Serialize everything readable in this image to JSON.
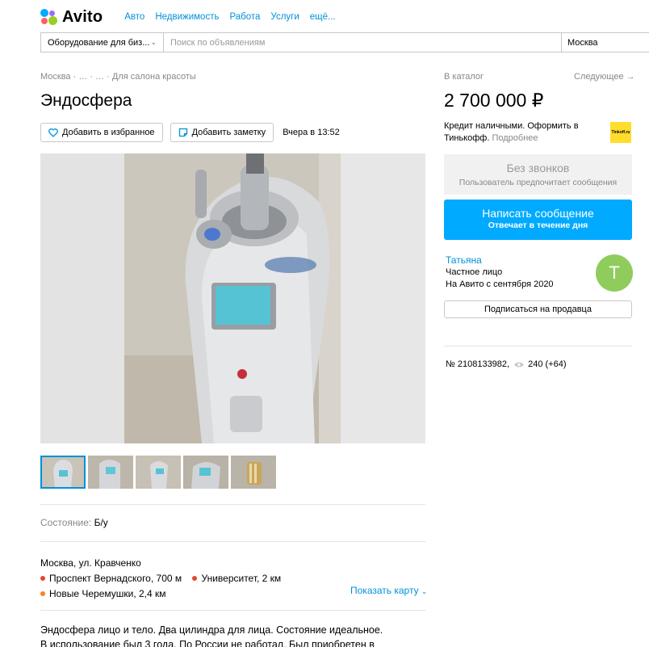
{
  "header": {
    "logo_text": "Avito",
    "nav": [
      "Авто",
      "Недвижимость",
      "Работа",
      "Услуги",
      "ещё..."
    ]
  },
  "search": {
    "category": "Оборудование для биз...",
    "placeholder": "Поиск по объявлениям",
    "city": "Москва"
  },
  "listing": {
    "breadcrumb": "Москва · … · … · Для салона красоты",
    "title": "Эндосфера",
    "favorite_label": "Добавить в избранное",
    "note_label": "Добавить заметку",
    "posted": "Вчера в 13:52",
    "condition_label": "Состояние:",
    "condition_value": "Б/у",
    "address": "Москва, ул. Кравченко",
    "metro": [
      {
        "name": "Проспект Вернадского, 700 м",
        "color": "#e8452a"
      },
      {
        "name": "Университет, 2 км",
        "color": "#e8452a"
      },
      {
        "name": "Новые Черемушки, 2,4 км",
        "color": "#f58220"
      }
    ],
    "show_map": "Показать карту",
    "description": "Эндосфера лицо и тело. Два цилиндра для лица. Состояние идеальное. В использование был 3 года. По России не работал. Был приобретен в салоне"
  },
  "sidebar": {
    "catalog": "В каталог",
    "next": "Следующее →",
    "price": "2 700 000 ₽",
    "credit_text": "Кредит наличными. Оформить в Тинькофф.",
    "credit_more": "Подробнее",
    "tinkoff_badge": "Tinkoff.ru",
    "no_calls_title": "Без звонков",
    "no_calls_sub": "Пользователь предпочитает сообщения",
    "message_title": "Написать сообщение",
    "message_sub": "Отвечает в течение дня",
    "seller_name": "Татьяна",
    "seller_type": "Частное лицо",
    "seller_since": "На Авито с сентября 2020",
    "avatar_letter": "Т",
    "subscribe": "Подписаться на продавца",
    "ad_number": "№ 2108133982,",
    "views": "240 (+64)"
  },
  "colors": {
    "link": "#0091d9",
    "primary_button": "#00aaff",
    "avatar": "#8fcc5c",
    "tinkoff": "#ffdd2d"
  }
}
